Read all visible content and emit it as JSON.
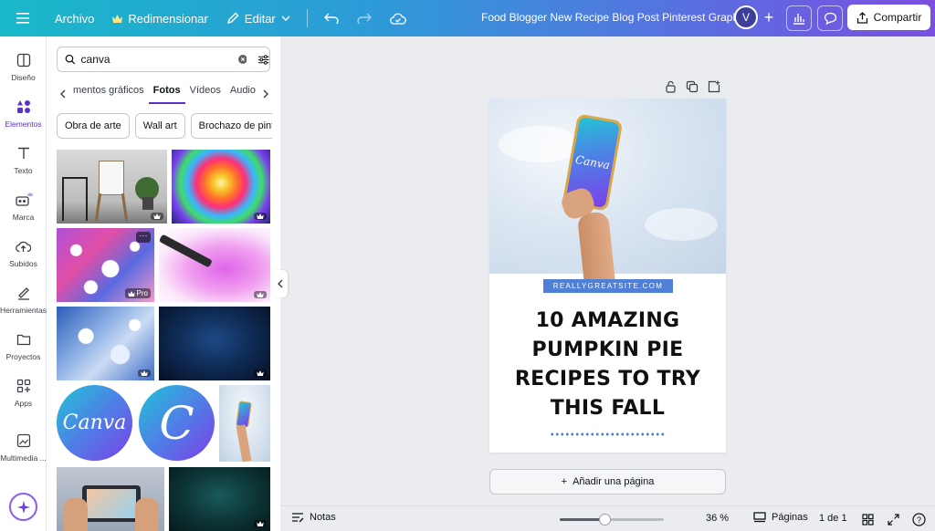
{
  "topbar": {
    "archivo": "Archivo",
    "redimensionar": "Redimensionar",
    "editar": "Editar",
    "doc_title": "Food Blogger New Recipe Blog Post Pinterest Graphic",
    "avatar_initial": "V",
    "plus": "+",
    "share_label": "Compartir",
    "icons": [
      "menu-icon",
      "crown-icon",
      "pencil-icon",
      "chevron-down-icon",
      "undo-icon",
      "redo-icon",
      "cloud-icon",
      "chart-icon",
      "comment-icon",
      "share-icon"
    ]
  },
  "rail": {
    "items": [
      {
        "label": "Diseño",
        "icon": "layout-icon"
      },
      {
        "label": "Elementos",
        "icon": "shapes-icon"
      },
      {
        "label": "Texto",
        "icon": "text-icon"
      },
      {
        "label": "Marca",
        "icon": "brand-icon"
      },
      {
        "label": "Subidos",
        "icon": "upload-cloud-icon"
      },
      {
        "label": "Herramientas",
        "icon": "tools-icon"
      },
      {
        "label": "Proyectos",
        "icon": "folder-icon"
      },
      {
        "label": "Apps",
        "icon": "apps-icon"
      },
      {
        "label": "Multimedia ...",
        "icon": "media-icon"
      }
    ],
    "active_index": 1
  },
  "panel": {
    "search_value": "canva",
    "tabs": [
      "mentos gráficos",
      "Fotos",
      "Vídeos",
      "Audio"
    ],
    "active_tab": 1,
    "chips": [
      "Obra de arte",
      "Wall art",
      "Brochazo de pintura"
    ],
    "pro_badge": "Pro",
    "logo_word": "Canva",
    "logo_letter": "C"
  },
  "canvas": {
    "site_label": "REALLYGREATSITE.COM",
    "headline_lines": [
      "10 AMAZING",
      "PUMPKIN PIE",
      "RECIPES TO TRY",
      "THIS FALL"
    ],
    "phone_logo": "Canva",
    "add_page_label": "Añadir una página",
    "add_page_plus": "+"
  },
  "bottombar": {
    "notes_label": "Notas",
    "zoom_percent": 36,
    "zoom_label": "36 %",
    "pages_label": "Páginas",
    "page_count": "1 de 1",
    "help": "?"
  },
  "colors": {
    "accent": "#5a32c8",
    "label_blue": "#4f7fd6"
  }
}
